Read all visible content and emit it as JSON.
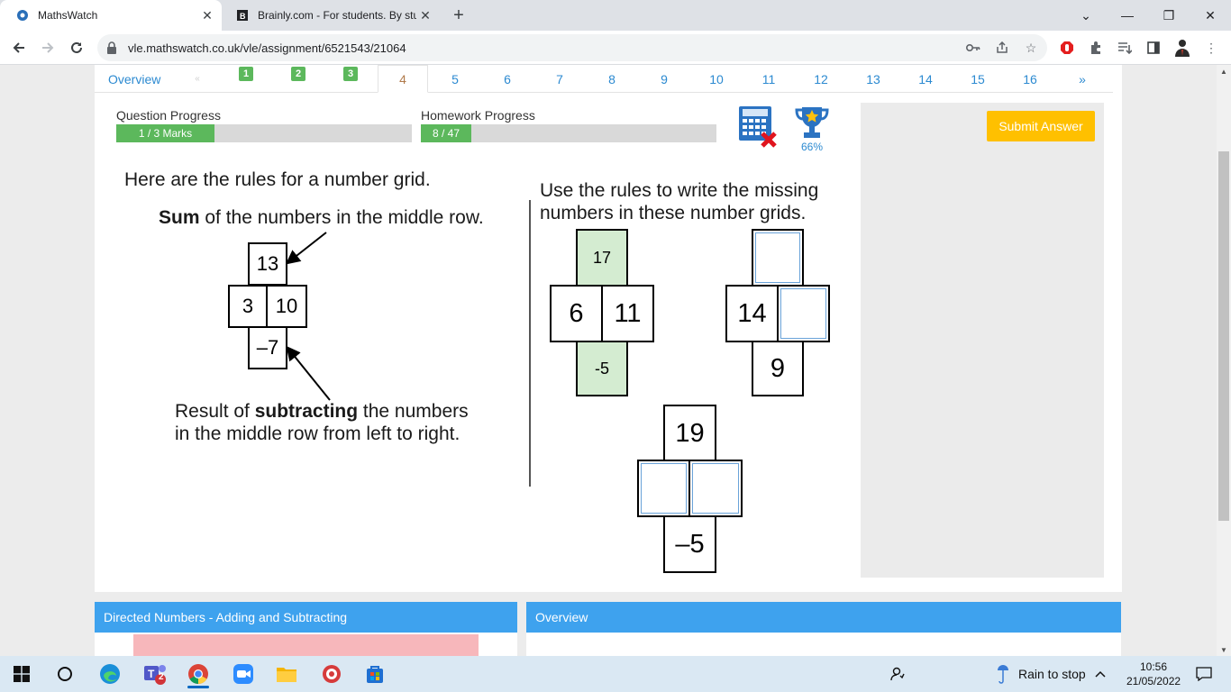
{
  "browser": {
    "tabs": [
      {
        "title": "MathsWatch",
        "active": true
      },
      {
        "title": "Brainly.com - For students. By stu",
        "active": false
      }
    ],
    "new_tab_symbol": "+",
    "close_symbol": "✕",
    "url": "vle.mathswatch.co.uk/vle/assignment/6521543/21064",
    "window_controls": {
      "minimize": "—",
      "maximize": "❐",
      "close": "✕",
      "tab_search": "⌄"
    }
  },
  "question_nav": {
    "overview": "Overview",
    "dots": "«",
    "completed": [
      "1",
      "2",
      "3"
    ],
    "current": "4",
    "items": [
      "5",
      "6",
      "7",
      "8",
      "9",
      "10",
      "11",
      "12",
      "13",
      "14",
      "15",
      "16"
    ],
    "next": "»"
  },
  "progress": {
    "question_label": "Question Progress",
    "question_value": "1 / 3 Marks",
    "question_fraction": 0.333,
    "homework_label": "Homework Progress",
    "homework_value": "8 / 47",
    "homework_fraction": 0.17
  },
  "calculator": {
    "icon": "calculator-not-allowed-icon"
  },
  "trophy": {
    "percent": "66%"
  },
  "submit": {
    "label": "Submit Answer"
  },
  "question": {
    "intro": "Here are the rules for a number grid.",
    "sum_bold": "Sum",
    "sum_rest": " of the numbers in the middle row.",
    "example": {
      "top": "13",
      "left": "3",
      "right": "10",
      "bottom": "–7"
    },
    "result_pre": "Result of ",
    "result_bold": "subtracting",
    "result_post": " the numbers",
    "result_line2": "in the middle row from left to right.",
    "instruction_line1": "Use the rules to write the missing",
    "instruction_line2": "numbers in these number grids.",
    "grid1": {
      "top": "17",
      "left": "6",
      "right": "11",
      "bottom": "-5"
    },
    "grid2": {
      "top": "",
      "left": "14",
      "right": "",
      "bottom": "9"
    },
    "grid3": {
      "top": "19",
      "left": "",
      "right": "",
      "bottom": "–5"
    }
  },
  "panels": {
    "left_title": "Directed Numbers - Adding and Subtracting",
    "right_title": "Overview"
  },
  "taskbar": {
    "weather": "Rain to stop",
    "time": "10:56",
    "date": "21/05/2022",
    "teams_badge": "2"
  },
  "colors": {
    "accent_blue": "#3ea2ee",
    "green": "#5cb85c",
    "submit_yellow": "#ffc000"
  }
}
